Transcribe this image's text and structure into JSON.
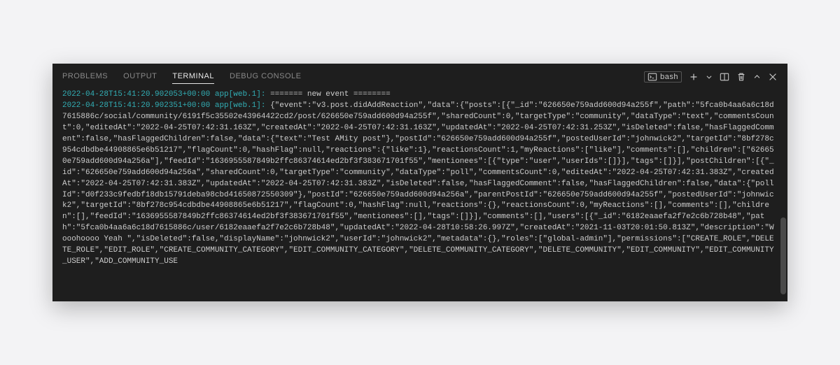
{
  "tabs": {
    "problems": "PROBLEMS",
    "output": "OUTPUT",
    "terminal": "TERMINAL",
    "debugconsole": "DEBUG CONSOLE"
  },
  "activeTab": 2,
  "shell": {
    "name": "bash"
  },
  "log": {
    "line1": {
      "ts": "2022-04-28T15:41:20.902053+00:00",
      "proc": "app[web.1]:",
      "msg": "======= new event ========"
    },
    "line2": {
      "ts": "2022-04-28T15:41:20.902351+00:00",
      "proc": "app[web.1]:",
      "msg": "{\"event\":\"v3.post.didAddReaction\",\"data\":{\"posts\":[{\"_id\":\"626650e759add600d94a255f\",\"path\":\"5fca0b4aa6a6c18d7615886c/social/community/6191f5c35502e43964422cd2/post/626650e759add600d94a255f\",\"sharedCount\":0,\"targetType\":\"community\",\"dataType\":\"text\",\"commentsCount\":0,\"editedAt\":\"2022-04-25T07:42:31.163Z\",\"createdAt\":\"2022-04-25T07:42:31.163Z\",\"updatedAt\":\"2022-04-25T07:42:31.253Z\",\"isDeleted\":false,\"hasFlaggedComment\":false,\"hasFlaggedChildren\":false,\"data\":{\"text\":\"Test AMity post\"},\"postId\":\"626650e759add600d94a255f\",\"postedUserId\":\"johnwick2\",\"targetId\":\"8bf278c954cdbdbe44908865e6b51217\",\"flagCount\":0,\"hashFlag\":null,\"reactions\":{\"like\":1},\"reactionsCount\":1,\"myReactions\":[\"like\"],\"comments\":[],\"children\":[\"626650e759add600d94a256a\"],\"feedId\":\"1636955587849b2ffc86374614ed2bf3f383671701f55\",\"mentionees\":[{\"type\":\"user\",\"userIds\":[]}],\"tags\":[]}],\"postChildren\":[{\"_id\":\"626650e759add600d94a256a\",\"sharedCount\":0,\"targetType\":\"community\",\"dataType\":\"poll\",\"commentsCount\":0,\"editedAt\":\"2022-04-25T07:42:31.383Z\",\"createdAt\":\"2022-04-25T07:42:31.383Z\",\"updatedAt\":\"2022-04-25T07:42:31.383Z\",\"isDeleted\":false,\"hasFlaggedComment\":false,\"hasFlaggedChildren\":false,\"data\":{\"pollId\":\"d0f233c9fedbf18db15791deba98cbd41650872550309\"},\"postId\":\"626650e759add600d94a256a\",\"parentPostId\":\"626650e759add600d94a255f\",\"postedUserId\":\"johnwick2\",\"targetId\":\"8bf278c954cdbdbe44908865e6b51217\",\"flagCount\":0,\"hashFlag\":null,\"reactions\":{},\"reactionsCount\":0,\"myReactions\":[],\"comments\":[],\"children\":[],\"feedId\":\"1636955587849b2ffc86374614ed2bf3f383671701f55\",\"mentionees\":[],\"tags\":[]}],\"comments\":[],\"users\":[{\"_id\":\"6182eaaefa2f7e2c6b728b48\",\"path\":\"5fca0b4aa6a6c18d7615886c/user/6182eaaefa2f7e2c6b728b48\",\"updatedAt\":\"2022-04-28T10:58:26.997Z\",\"createdAt\":\"2021-11-03T20:01:50.813Z\",\"description\":\"Wooohoooo Yeah \",\"isDeleted\":false,\"displayName\":\"johnwick2\",\"userId\":\"johnwick2\",\"metadata\":{},\"roles\":[\"global-admin\"],\"permissions\":[\"CREATE_ROLE\",\"DELETE_ROLE\",\"EDIT_ROLE\",\"CREATE_COMMUNITY_CATEGORY\",\"EDIT_COMMUNITY_CATEGORY\",\"DELETE_COMMUNITY_CATEGORY\",\"DELETE_COMMUNITY\",\"EDIT_COMMUNITY\",\"EDIT_COMMUNITY_USER\",\"ADD_COMMUNITY_USE"
    }
  }
}
